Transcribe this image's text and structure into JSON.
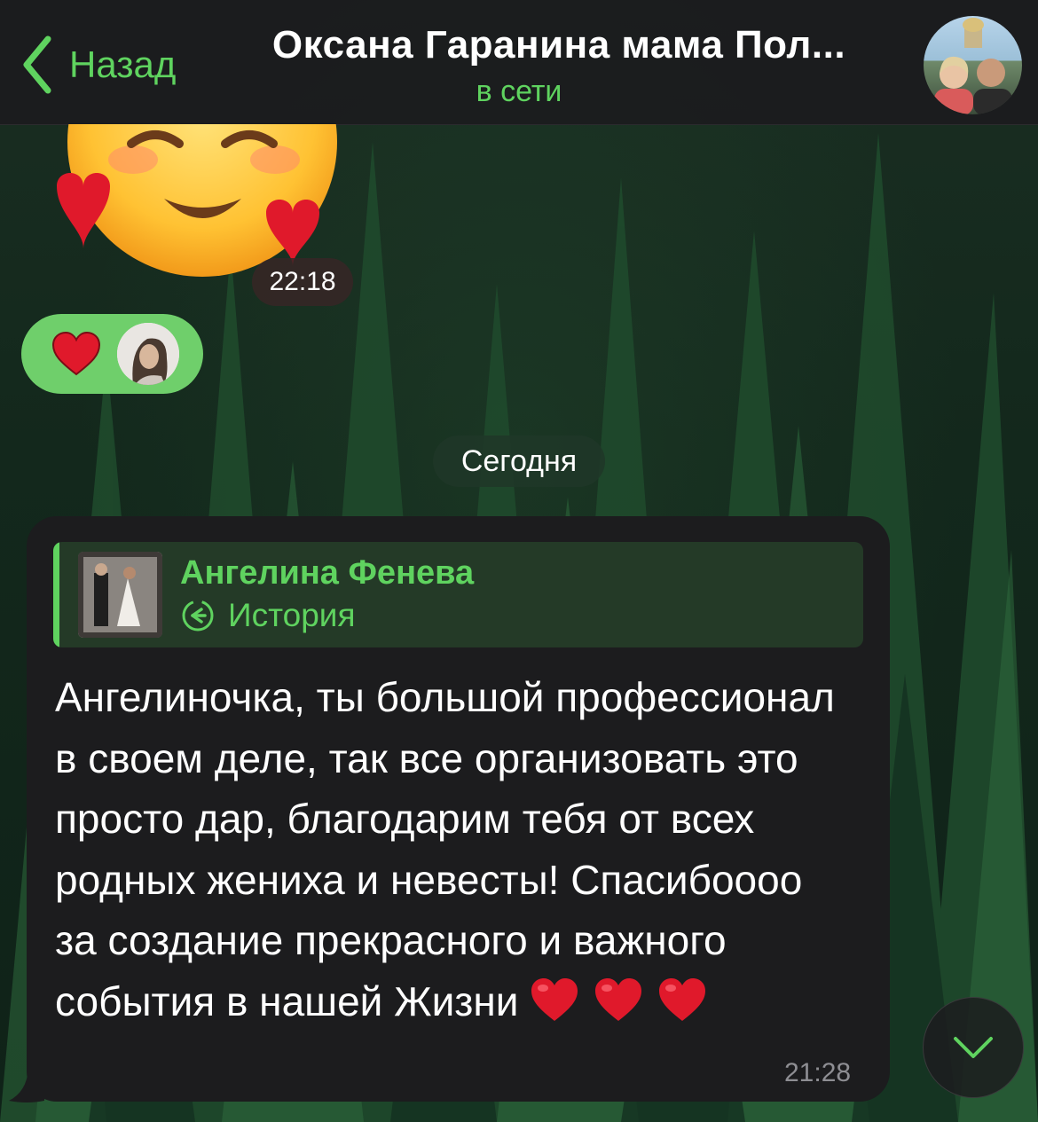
{
  "header": {
    "back_label": "Назад",
    "title": "Оксана Гаранина мама Пол...",
    "status": "в сети"
  },
  "sticker_message": {
    "time": "22:18"
  },
  "reaction_message": {
    "reaction": "heart"
  },
  "date_separator": "Сегодня",
  "message": {
    "reply": {
      "author": "Ангелина Фенева",
      "type": "История"
    },
    "text": "Ангелиночка, ты большой профессионал в своем деле, так все организовать это просто дар, благодарим тебя от всех родных жениха и невесты! Спасибоооо за создание прекрасного и важного события в нашей Жизни",
    "time": "21:28"
  },
  "colors": {
    "accent": "#5fd35f",
    "bubble": "#1c1c1e",
    "reaction_bg": "#6fcf6b",
    "heart": "#e0192b"
  },
  "icons": {
    "back": "chevron-left-icon",
    "story": "story-icon",
    "scroll": "chevron-down-icon"
  }
}
